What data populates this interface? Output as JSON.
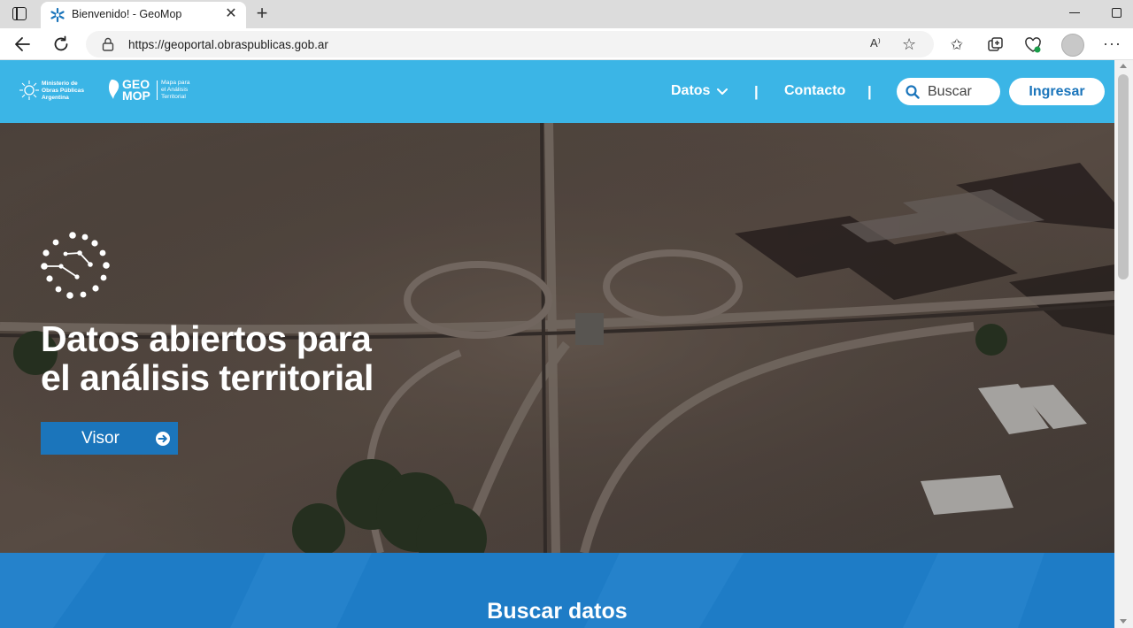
{
  "browser": {
    "tab_title": "Bienvenido! - GeoMop",
    "url": "https://geoportal.obraspublicas.gob.ar",
    "read_aloud_label": "A⁾",
    "new_tab_glyph": "+",
    "close_glyph": "✕",
    "menu_glyph": "···",
    "icons": [
      "sidebar-toggle-icon",
      "geomop-favicon",
      "close-icon",
      "new-tab-icon",
      "back-icon",
      "reload-icon",
      "lock-icon",
      "read-aloud-icon",
      "favorite-star-icon",
      "favorites-icon",
      "collections-icon",
      "browser-essentials-icon",
      "profile-avatar",
      "more-menu-icon"
    ]
  },
  "header": {
    "ministry_logo_text": [
      "Ministerio de",
      "Obras Públicas",
      "Argentina"
    ],
    "geomop_word": [
      "GEO",
      "MOP"
    ],
    "geomop_tagline": [
      "Mapa para",
      "el Análisis",
      "Territorial"
    ],
    "nav": {
      "datos": "Datos",
      "separator": "|",
      "contacto": "Contacto"
    },
    "search_placeholder": "Buscar",
    "login_label": "Ingresar",
    "colors": {
      "header_bg": "#3bb5e6",
      "accent": "#1b75bb"
    }
  },
  "hero": {
    "title_line1": "Datos abiertos para",
    "title_line2": "el análisis territorial",
    "visor_label": "Visor",
    "background": "aerial photo of highway interchange"
  },
  "search_section": {
    "title": "Buscar datos",
    "bg_color": "#1e7cc6"
  }
}
